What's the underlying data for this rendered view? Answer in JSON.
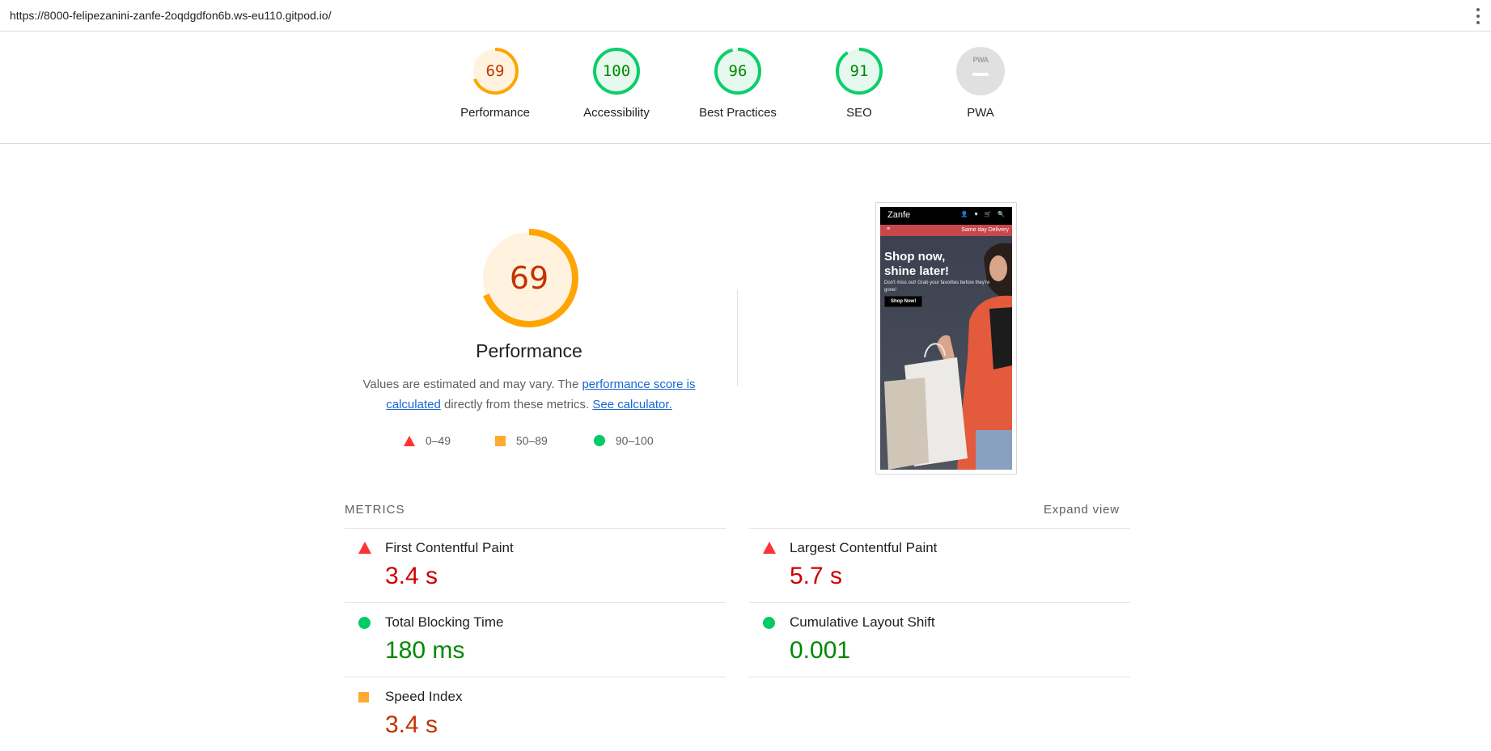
{
  "browser": {
    "url": "https://8000-felipezanini-zanfe-2oqdgdfon6b.ws-eu110.gitpod.io/"
  },
  "gauges": [
    {
      "score": "69",
      "label": "Performance",
      "value": 69,
      "color": "#ffa400",
      "bg": "#fff3e0",
      "text_color": "#c33300"
    },
    {
      "score": "100",
      "label": "Accessibility",
      "value": 100,
      "color": "#0cce6b",
      "bg": "#e6f9ee",
      "text_color": "#008800"
    },
    {
      "score": "96",
      "label": "Best Practices",
      "value": 96,
      "color": "#0cce6b",
      "bg": "#e6f9ee",
      "text_color": "#008800"
    },
    {
      "score": "91",
      "label": "SEO",
      "value": 91,
      "color": "#0cce6b",
      "bg": "#e6f9ee",
      "text_color": "#008800"
    },
    {
      "score": "PWA",
      "label": "PWA",
      "value": null,
      "color": "#cccccc",
      "bg": "#e0e0e0",
      "text_color": "#9e9e9e"
    }
  ],
  "performance": {
    "score": "69",
    "value": 69,
    "title": "Performance",
    "desc_prefix": "Values are estimated and may vary. The ",
    "desc_link1": "performance score is calculated",
    "desc_mid": " directly from these metrics. ",
    "desc_link2": "See calculator.",
    "legend": [
      {
        "shape": "triangle",
        "label": "0–49",
        "color": "#ff3333"
      },
      {
        "shape": "square",
        "label": "50–89",
        "color": "#ffaa33"
      },
      {
        "shape": "circle",
        "label": "90–100",
        "color": "#00cc66"
      }
    ]
  },
  "thumbnail": {
    "brand": "Zanfe",
    "icons": "👤 ♥ 🛒 🔍",
    "menu_icon": "≡",
    "delivery": "Same day Delivery",
    "headline": "Shop now, shine later!",
    "subtext": "Don't miss out! Grab your favorites before they're gone!",
    "button": "Shop Now!"
  },
  "metrics": {
    "header": "METRICS",
    "expand": "Expand view",
    "left": [
      {
        "name": "First Contentful Paint",
        "value": "3.4 s",
        "rating": "fail"
      },
      {
        "name": "Total Blocking Time",
        "value": "180 ms",
        "rating": "pass"
      },
      {
        "name": "Speed Index",
        "value": "3.4 s",
        "rating": "average"
      }
    ],
    "right": [
      {
        "name": "Largest Contentful Paint",
        "value": "5.7 s",
        "rating": "fail"
      },
      {
        "name": "Cumulative Layout Shift",
        "value": "0.001",
        "rating": "pass"
      }
    ]
  }
}
